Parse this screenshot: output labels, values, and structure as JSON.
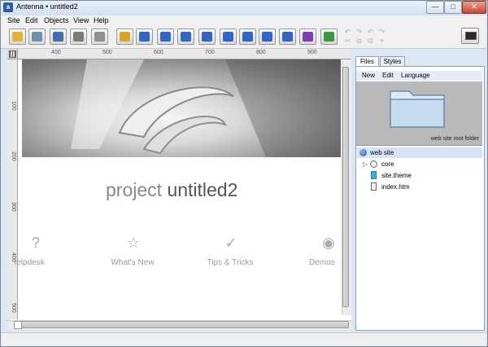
{
  "window": {
    "title": "Antenna • untitled2",
    "app_icon_letter": "a",
    "controls": {
      "minimize": "—",
      "maximize": "□",
      "close": "✕"
    }
  },
  "menubar": {
    "items": [
      "Site",
      "Edit",
      "Objects",
      "View",
      "Help"
    ]
  },
  "toolbar": {
    "buttons": [
      {
        "icon": "open-folder-icon",
        "color": "#e8b23a"
      },
      {
        "icon": "save-disk-icon",
        "color": "#6d8fb3"
      },
      {
        "icon": "publish-icon",
        "color": "#3f6fb0"
      },
      {
        "icon": "preview-eye-icon",
        "color": "#7a7a7a"
      },
      {
        "icon": "globe-icon",
        "color": "#909090"
      },
      {
        "icon": "pen-icon",
        "color": "#d9a520"
      },
      {
        "icon": "rectangle-icon",
        "color": "#2f67c9"
      },
      {
        "icon": "camera-icon",
        "color": "#2f67c9"
      },
      {
        "icon": "text-icon",
        "color": "#2f67c9"
      },
      {
        "icon": "picture-icon",
        "color": "#2f67c9"
      },
      {
        "icon": "image-frame-icon",
        "color": "#2f67c9"
      },
      {
        "icon": "monitor-icon",
        "color": "#2f67c9"
      },
      {
        "icon": "sound-icon",
        "color": "#2f67c9"
      },
      {
        "icon": "media-disc-icon",
        "color": "#2f67c9"
      },
      {
        "icon": "script-icon",
        "color": "#7a3fb0"
      },
      {
        "icon": "checkbox-icon",
        "color": "#3b9a3b"
      }
    ],
    "disabled_glyphs": [
      "↶",
      "↷",
      "↶",
      "↷",
      "✂",
      "⧉",
      "⧉",
      "⌖"
    ],
    "right_icon": "screen-icon"
  },
  "ruler": {
    "top_labels": [
      "400",
      "500",
      "600",
      "700",
      "800",
      "900"
    ],
    "left_labels": [
      "100",
      "200",
      "300",
      "400",
      "500"
    ]
  },
  "page": {
    "title_light": "project",
    "title_dark": "untitled2",
    "nav": [
      {
        "icon": "?",
        "icon_name": "help-icon",
        "label": "Helpdesk"
      },
      {
        "icon": "☆",
        "icon_name": "star-icon",
        "label": "What's New"
      },
      {
        "icon": "✓",
        "icon_name": "checkmark-icon",
        "label": "Tips & Tricks"
      },
      {
        "icon": "◉",
        "icon_name": "eye-film-icon",
        "label": "Demos"
      }
    ]
  },
  "right_panel": {
    "tabs": [
      "Files",
      "Styles"
    ],
    "menu": [
      "New",
      "Edit",
      "Language"
    ],
    "folder_caption": "web site root folder",
    "tree": {
      "root": "web site",
      "items": [
        {
          "label": "core",
          "icon": "folder-globe-icon",
          "expandable": true
        },
        {
          "label": "site.theme",
          "icon": "theme-file-icon",
          "expandable": false
        },
        {
          "label": "index.htm",
          "icon": "html-file-icon",
          "expandable": false
        }
      ]
    }
  },
  "colors": {
    "accent": "#2f67c9",
    "title_light": "#888888",
    "title_dark": "#555555"
  }
}
